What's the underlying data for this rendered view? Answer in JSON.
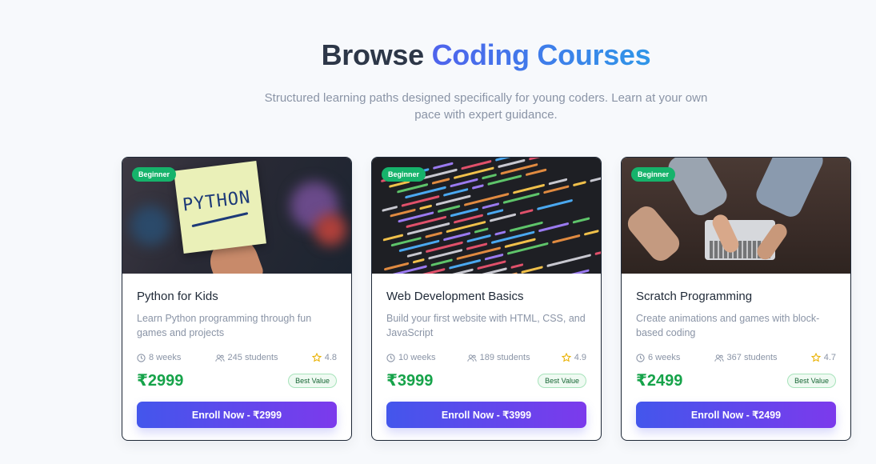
{
  "header": {
    "title_prefix": "Browse",
    "title_accent": "Coding Courses",
    "subtitle": "Structured learning paths designed specifically for young coders. Learn at your own pace with expert guidance."
  },
  "courses": [
    {
      "badge": "Beginner",
      "image_label": "PYTHON",
      "title": "Python for Kids",
      "description": "Learn Python programming through fun games and projects",
      "duration": "8 weeks",
      "students": "245 students",
      "rating": "4.8",
      "price": "₹2999",
      "value_badge": "Best Value",
      "enroll_label": "Enroll Now - ₹2999"
    },
    {
      "badge": "Beginner",
      "title": "Web Development Basics",
      "description": "Build your first website with HTML, CSS, and JavaScript",
      "duration": "10 weeks",
      "students": "189 students",
      "rating": "4.9",
      "price": "₹3999",
      "value_badge": "Best Value",
      "enroll_label": "Enroll Now - ₹3999"
    },
    {
      "badge": "Beginner",
      "title": "Scratch Programming",
      "description": "Create animations and games with block-based coding",
      "duration": "6 weeks",
      "students": "367 students",
      "rating": "4.7",
      "price": "₹2499",
      "value_badge": "Best Value",
      "enroll_label": "Enroll Now - ₹2499"
    }
  ],
  "icons": {
    "duration": "clock-icon",
    "students": "users-icon",
    "rating": "star-icon"
  },
  "colors": {
    "badge_green": "#16b36b",
    "price_green": "#16a34a",
    "button_gradient_start": "#4356ec",
    "button_gradient_end": "#7c3aec",
    "title_accent_start": "#4f63ec",
    "title_accent_end": "#2f96e8",
    "star": "#eab308"
  }
}
